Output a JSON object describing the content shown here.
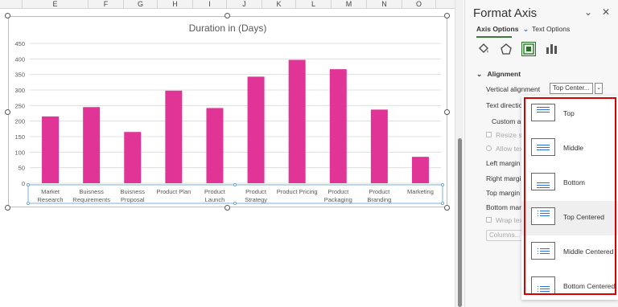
{
  "sheet": {
    "columns": [
      "E",
      "F",
      "G",
      "H",
      "I",
      "J",
      "K",
      "L",
      "M",
      "N",
      "O"
    ]
  },
  "chart_data": {
    "type": "bar",
    "title": "Duration in (Days)",
    "categories": [
      [
        "Market",
        "Research"
      ],
      [
        "Buisness",
        "Requirements"
      ],
      [
        "Buisness",
        "Proposal"
      ],
      [
        "Product Plan"
      ],
      [
        "Product",
        "Launch"
      ],
      [
        "Product",
        "Strategy"
      ],
      [
        "Product Pricing"
      ],
      [
        "Product",
        "Packaging"
      ],
      [
        "Product",
        "Branding"
      ],
      [
        "Marketing"
      ]
    ],
    "values": [
      215,
      245,
      165,
      298,
      242,
      343,
      397,
      367,
      237,
      85
    ],
    "ylim": [
      0,
      450
    ],
    "yticks": [
      "0",
      "50",
      "100",
      "150",
      "200",
      "250",
      "300",
      "350",
      "400",
      "450"
    ],
    "grid": true,
    "color": "#e03597"
  },
  "pane": {
    "title": "Format Axis",
    "dropdown_arrow": "⌄",
    "close": "✕",
    "tab_axis": "Axis Options",
    "tab_axis_chevron": "⌄",
    "tab_text": "Text Options",
    "section": "Alignment",
    "section_chevron": "⌄",
    "vertical_alignment_label": "Vertical alignment",
    "vertical_alignment_value": "Top Center...",
    "select_arrow": "⌄",
    "text_direction_label": "Text direction",
    "custom_angle_label": "Custom an",
    "resize_shape_label": "Resize sh",
    "allow_text_label": "Allow tex",
    "left_margin_label": "Left margin",
    "right_margin_label": "Right margin",
    "top_margin_label": "Top margin",
    "bottom_margin_label": "Bottom marg",
    "wrap_text_label": "Wrap tex",
    "columns_button": "Columns..."
  },
  "dropdown": {
    "items": [
      "Top",
      "Middle",
      "Bottom",
      "Top Centered",
      "Middle Centered",
      "Bottom Centered"
    ],
    "hovered": "Top Centered",
    "highlight_color": "#d90000"
  }
}
